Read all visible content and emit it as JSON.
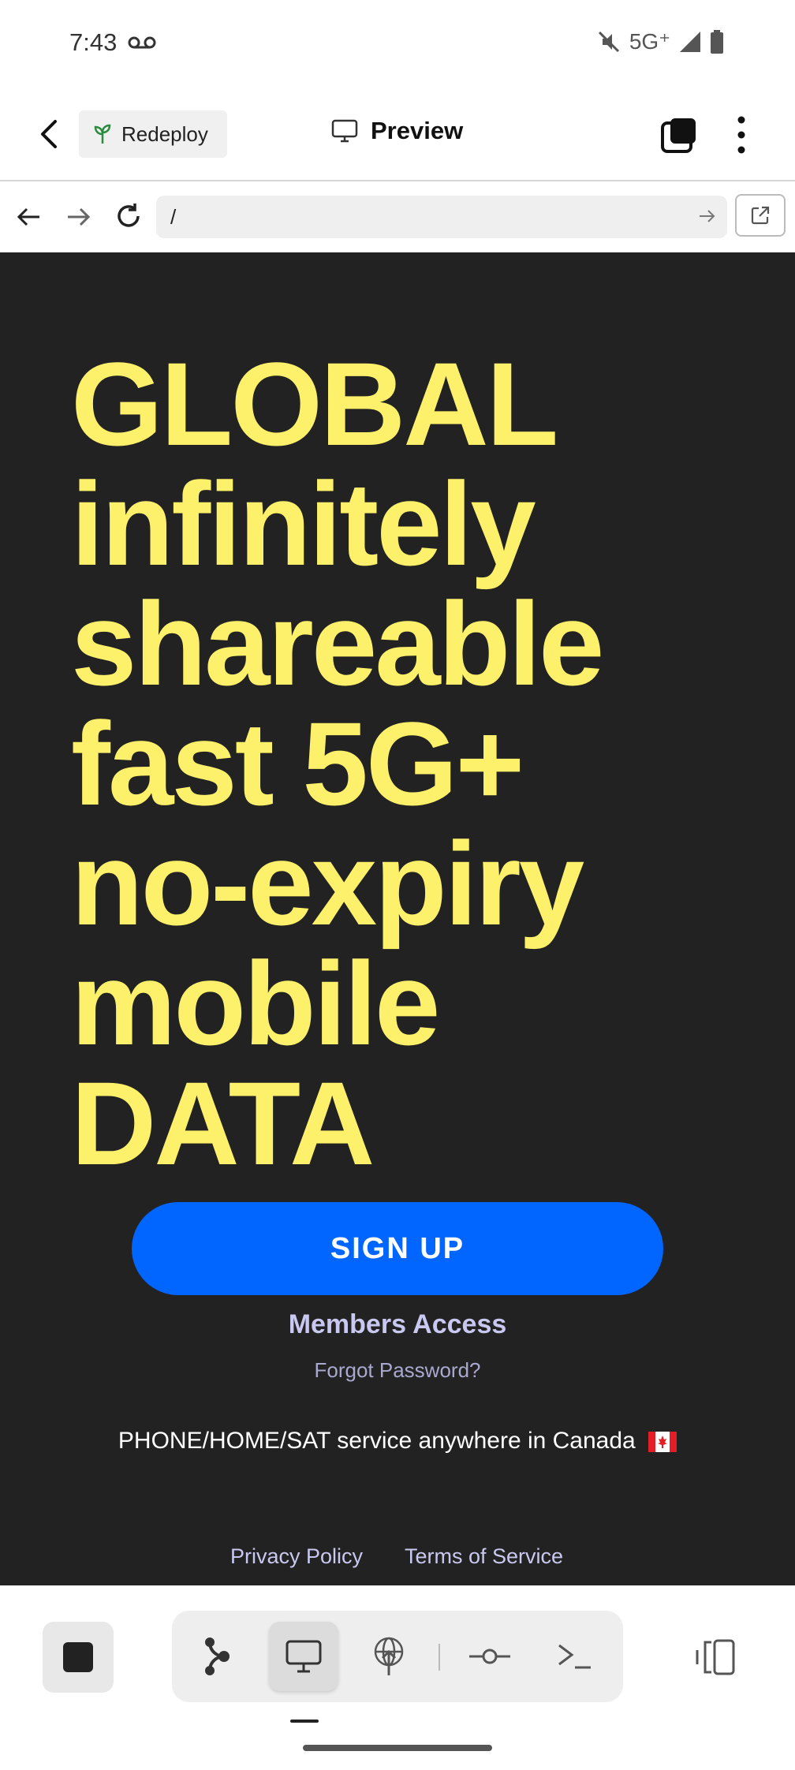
{
  "status_bar": {
    "time": "7:43",
    "network": "5G⁺",
    "icons": [
      "voicemail-icon",
      "mute-icon",
      "signal-icon",
      "battery-icon"
    ]
  },
  "app_header": {
    "redeploy_label": "Redeploy",
    "preview_label": "Preview",
    "icons": [
      "back-icon",
      "sprout-icon",
      "monitor-icon",
      "tabs-icon",
      "more-vert-icon"
    ]
  },
  "browser": {
    "url": "/",
    "icons": [
      "arrow-left-icon",
      "arrow-right-icon",
      "reload-icon",
      "go-arrow-icon",
      "open-external-icon"
    ]
  },
  "page": {
    "headline_lines": [
      "GLOBAL",
      "infinitely",
      "shareable",
      "fast 5G+",
      "no-expiry",
      "mobile",
      "DATA"
    ],
    "signup_label": "SIGN UP",
    "members_label": "Members Access",
    "forgot_label": "Forgot Password?",
    "service_text": "PHONE/HOME/SAT service anywhere in Canada",
    "privacy_label": "Privacy Policy",
    "terms_label": "Terms of Service",
    "colors": {
      "background": "#222222",
      "headline": "#fdf06a",
      "signup": "#0066ff",
      "links": "#c9c8f0"
    }
  },
  "bottom_toolbar": {
    "icons": [
      "stop-icon",
      "workflow-icon",
      "monitor-icon",
      "network-icon",
      "commit-icon",
      "terminal-icon",
      "side-panel-icon"
    ],
    "active_tool": "monitor-icon"
  }
}
